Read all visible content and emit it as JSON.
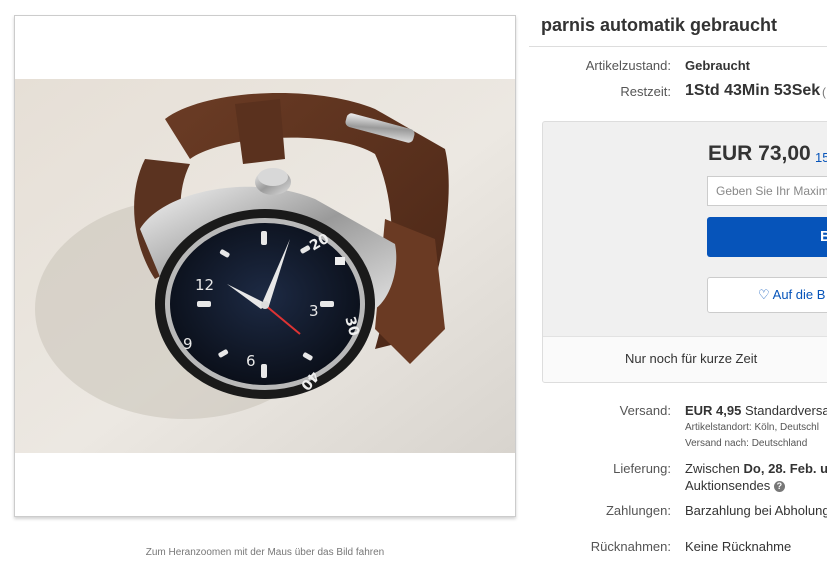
{
  "listing": {
    "title": "parnis automatik gebraucht",
    "zoom_hint": "Zum Heranzoomen mit der Maus über das Bild fahren"
  },
  "details": {
    "condition_label": "Artikelzustand:",
    "condition_value": "Gebraucht",
    "time_label": "Restzeit:",
    "time_value": "1Std 43Min 53Sek",
    "time_icon": "("
  },
  "bid": {
    "price": "EUR 73,00",
    "bid_count": "15",
    "input_placeholder": "Geben Sie Ihr Maxim",
    "bid_button_label": "B",
    "watch_icon": "heart-icon",
    "watch_label": "Auf die B",
    "urgency": "Nur noch für kurze Zeit"
  },
  "shipping": {
    "label": "Versand:",
    "price": "EUR 4,95",
    "method": "Standardversa",
    "location": "Artikelstandort:  Köln, Deutschl",
    "ships_to": "Versand nach:  Deutschland"
  },
  "delivery": {
    "label": "Lieferung:",
    "text_prefix": "Zwischen ",
    "text_date": "Do, 28. Feb. u",
    "line2": "Auktionsendes",
    "help_icon": "?"
  },
  "payment": {
    "label": "Zahlungen:",
    "value": "Barzahlung bei Abholung"
  },
  "returns": {
    "label": "Rücknahmen:",
    "value": "Keine Rücknahme"
  },
  "watch_dial": {
    "numerals": [
      "12",
      "9",
      "6",
      "3"
    ],
    "bezel": [
      "20",
      "30",
      "40"
    ]
  }
}
